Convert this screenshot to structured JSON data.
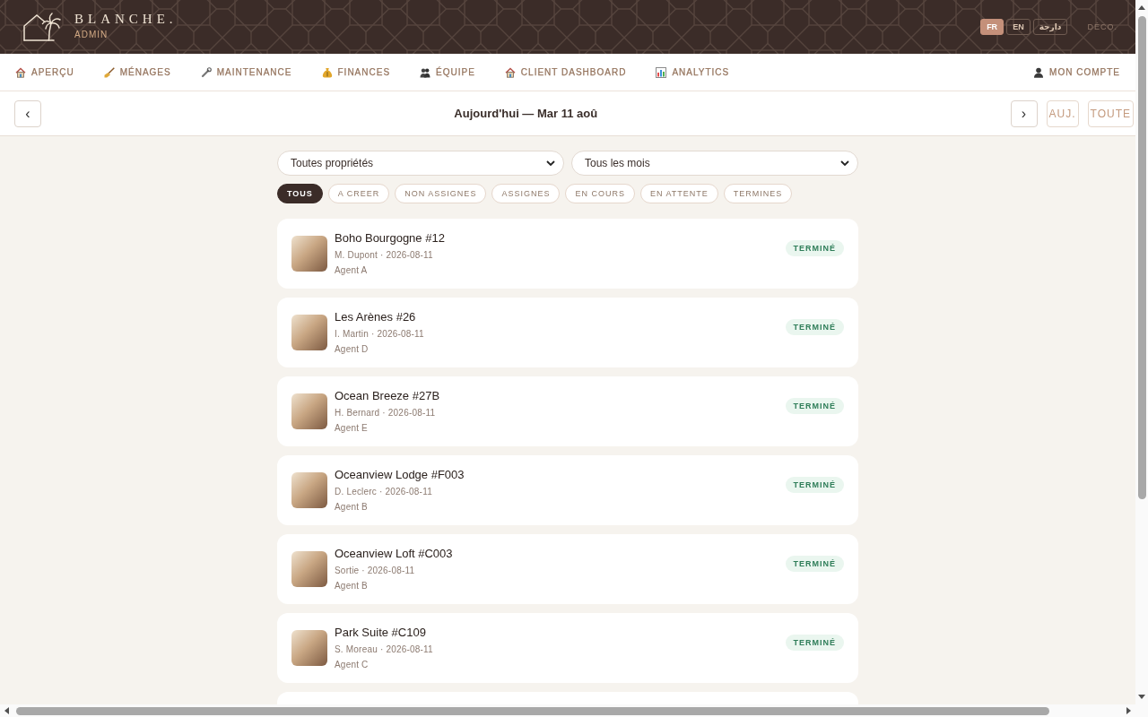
{
  "header": {
    "brand": "BLANCHE.",
    "subtitle": "ADMIN",
    "languages": [
      {
        "label": "FR",
        "selected": true
      },
      {
        "label": "EN",
        "selected": false
      },
      {
        "label": "دارجة",
        "selected": false
      }
    ],
    "logout": "DÉCO."
  },
  "nav": {
    "items": [
      {
        "label": "APERÇU",
        "kind": "overview"
      },
      {
        "label": "MÉNAGES",
        "kind": "cleaning"
      },
      {
        "label": "MAINTENANCE",
        "kind": "maintenance"
      },
      {
        "label": "FINANCES",
        "kind": "finances"
      },
      {
        "label": "ÉQUIPE",
        "kind": "team"
      },
      {
        "label": "CLIENT DASHBOARD",
        "kind": "client"
      },
      {
        "label": "ANALYTICS",
        "kind": "analytics"
      }
    ],
    "account": {
      "label": "MON COMPTE",
      "kind": "account"
    }
  },
  "date_bar": {
    "previous": "‹",
    "title": "Aujourd'hui — Mar 11 aoû",
    "next": "›",
    "today": "AUJ.",
    "all": "TOUTE"
  },
  "filters": {
    "dropdowns": [
      {
        "value": "Toutes propriétés"
      },
      {
        "value": "Tous les mois"
      }
    ],
    "chips": [
      {
        "label": "TOUS",
        "selected": true
      },
      {
        "label": "A CREER",
        "selected": false
      },
      {
        "label": "NON ASSIGNES",
        "selected": false
      },
      {
        "label": "ASSIGNES",
        "selected": false
      },
      {
        "label": "EN COURS",
        "selected": false
      },
      {
        "label": "EN ATTENTE",
        "selected": false
      },
      {
        "label": "TERMINES",
        "selected": false
      }
    ]
  },
  "cards": [
    {
      "title": "Boho Bourgogne #12",
      "meta": "M. Dupont · 2026-08-11",
      "agent": "Agent A",
      "status": "TERMINÉ"
    },
    {
      "title": "Les Arènes #26",
      "meta": "I. Martin · 2026-08-11",
      "agent": "Agent D",
      "status": "TERMINÉ"
    },
    {
      "title": "Ocean Breeze #27B",
      "meta": "H. Bernard · 2026-08-11",
      "agent": "Agent E",
      "status": "TERMINÉ"
    },
    {
      "title": "Oceanview Lodge #F003",
      "meta": "D. Leclerc · 2026-08-11",
      "agent": "Agent B",
      "status": "TERMINÉ"
    },
    {
      "title": "Oceanview Loft #C003",
      "meta": "Sortie · 2026-08-11",
      "agent": "Agent B",
      "status": "TERMINÉ"
    },
    {
      "title": "Park Suite #C109",
      "meta": "S. Moreau · 2026-08-11",
      "agent": "Agent C",
      "status": "TERMINÉ"
    }
  ]
}
